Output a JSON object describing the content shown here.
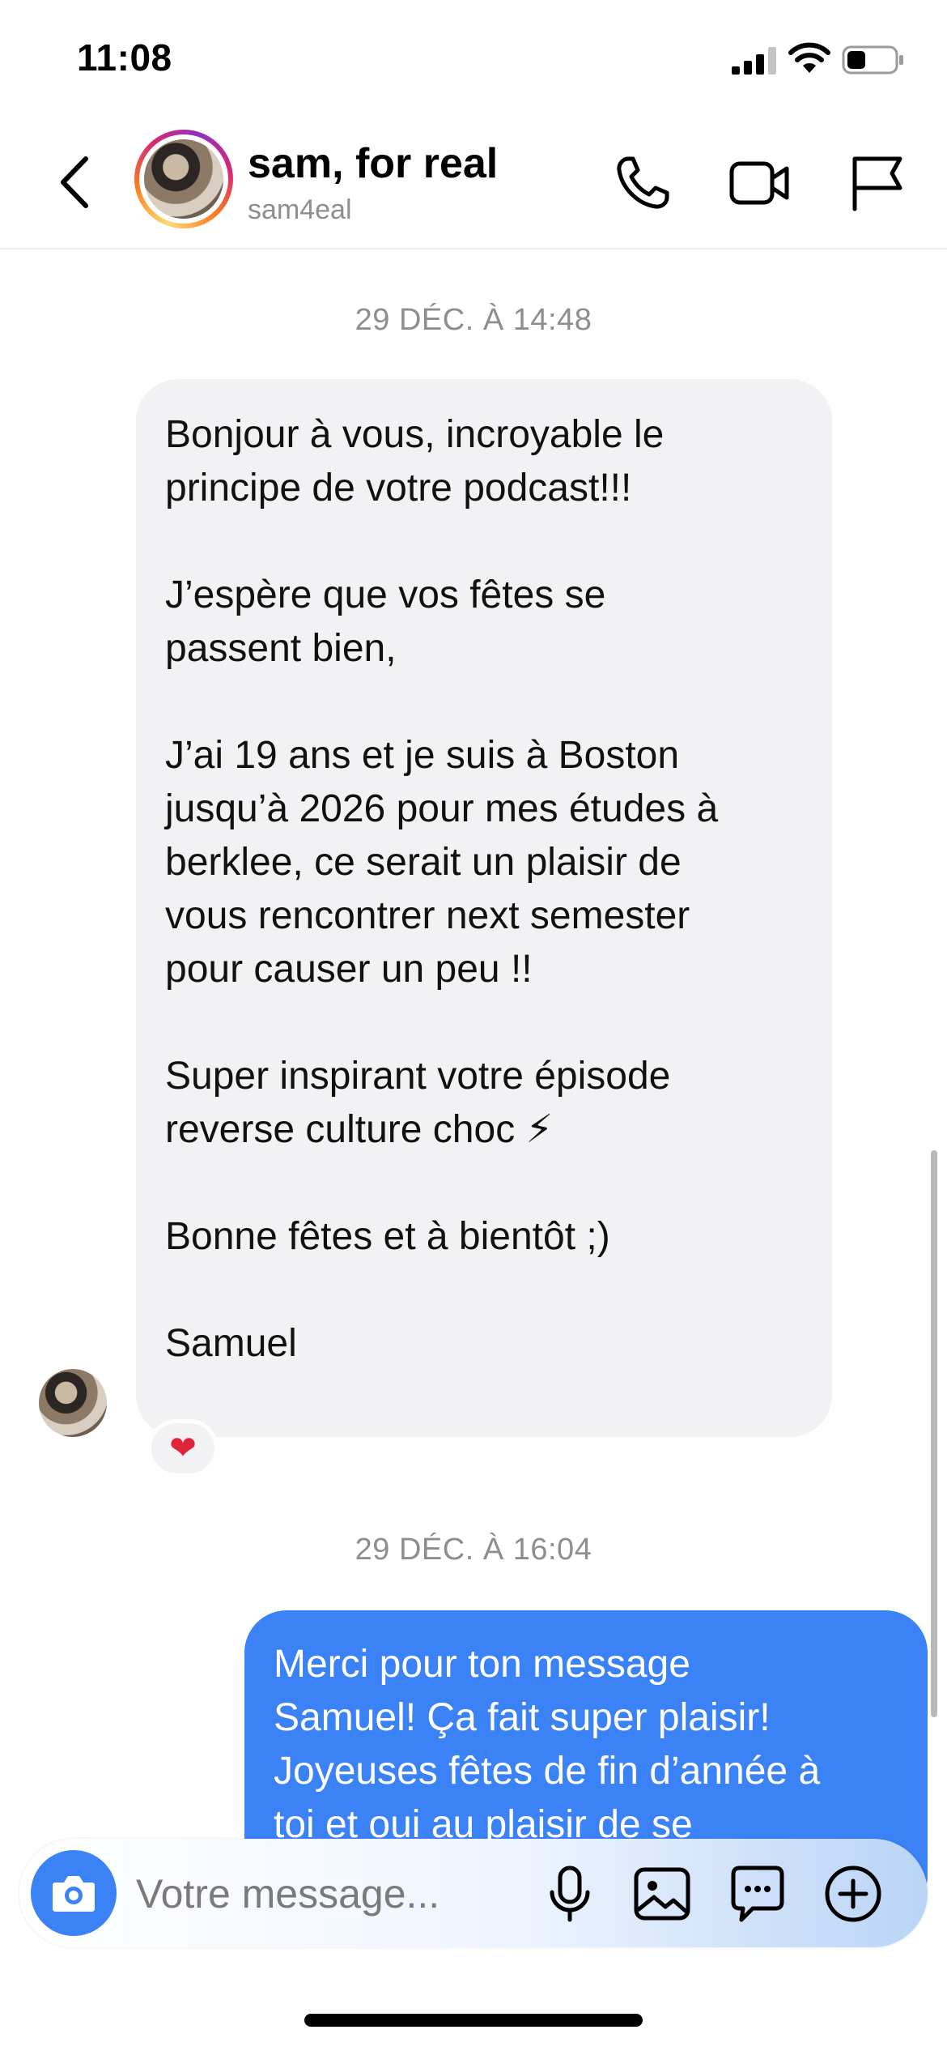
{
  "status_bar": {
    "time": "11:08"
  },
  "header": {
    "contact_name": "sam, for real",
    "username": "sam4eal",
    "icons": [
      "back-icon",
      "phone-icon",
      "video-camera-icon",
      "flag-icon"
    ]
  },
  "messages": [
    {
      "timestamp": "29 DÉC. À 14:48",
      "direction": "incoming",
      "text": "Bonjour à vous, incroyable le\nprincipe de votre podcast!!!\n\nJ’espère que vos fêtes se\npassent bien,\n\nJ’ai 19 ans et je suis à Boston\njusqu’à 2026 pour mes études à\nberklee, ce serait un plaisir de\nvous rencontrer next semester\npour causer un peu !!\n\nSuper inspirant votre épisode\nreverse culture choc ⚡\n\nBonne fêtes et à bientôt ;)\n\nSamuel",
      "reaction": "❤"
    },
    {
      "timestamp": "29 DÉC. À 16:04",
      "direction": "outgoing",
      "text": "Merci pour ton message\nSamuel! Ça fait super plaisir!\nJoyeuses fêtes de fin d’année à\ntoi et oui au plaisir de se"
    }
  ],
  "composer": {
    "placeholder": "Votre message...",
    "icons": [
      "camera-icon",
      "microphone-icon",
      "gallery-icon",
      "sticker-icon",
      "plus-icon"
    ]
  },
  "colors": {
    "outgoing_bubble": "#3b82f6",
    "incoming_bubble": "#f2f2f4",
    "timestamp": "#8e8e8e"
  }
}
